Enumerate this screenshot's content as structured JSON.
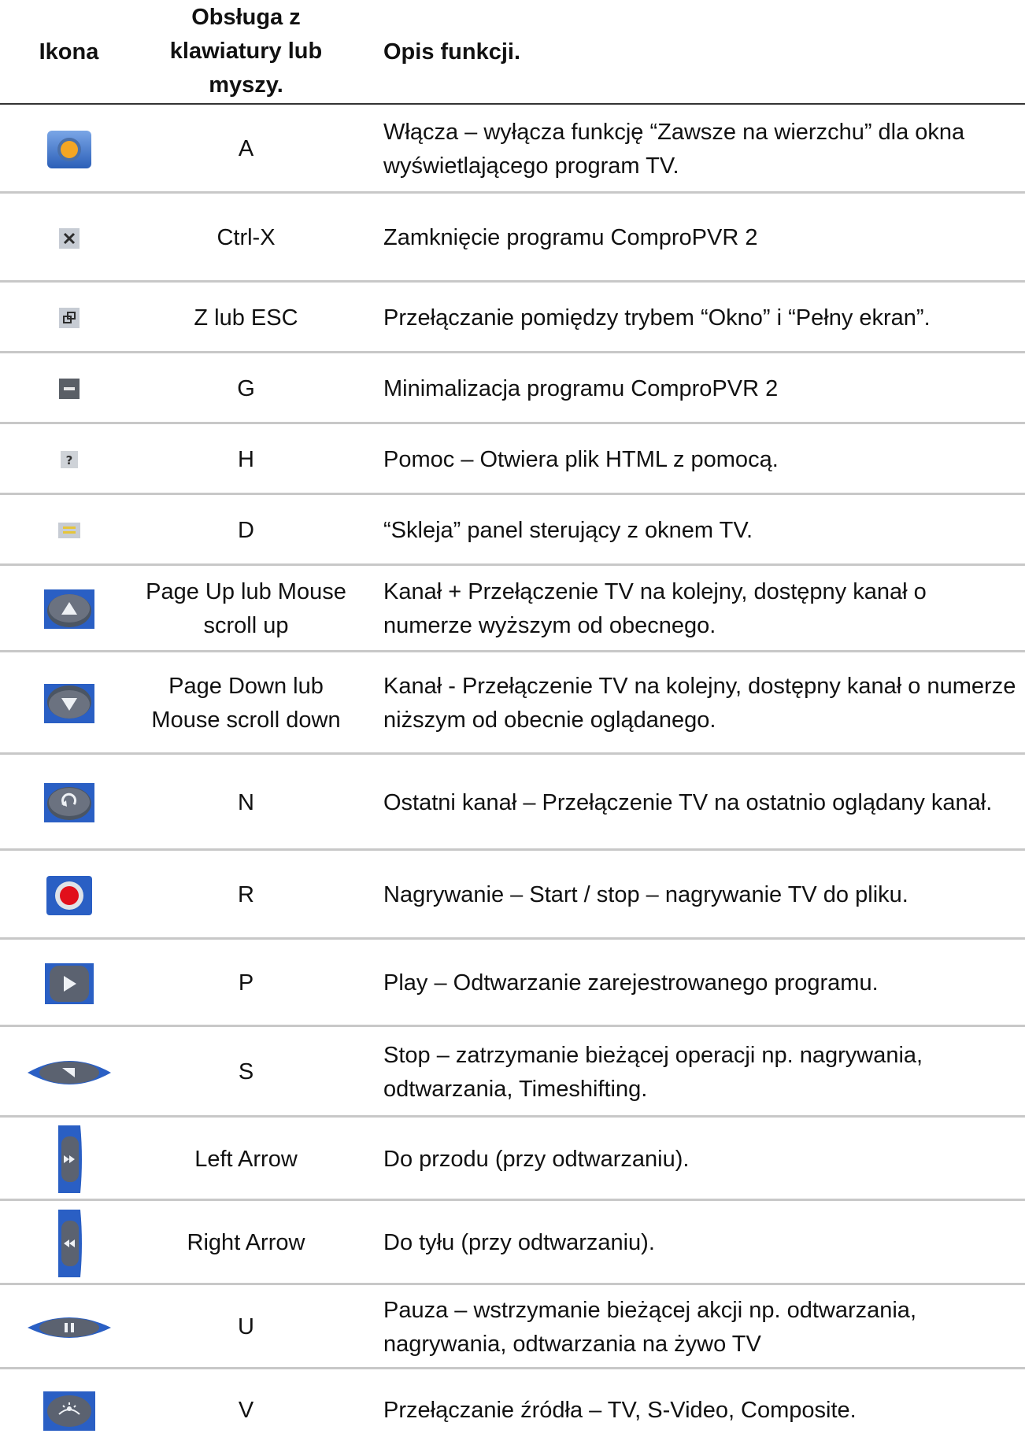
{
  "header": {
    "col_icon": "Ikona",
    "col_key": "Obsługa z klawiatury lub myszy.",
    "col_desc": "Opis funkcji."
  },
  "rows": [
    {
      "icon": "always-on-top-icon",
      "key": "A",
      "desc": "Włącza – wyłącza funkcję “Zawsze na wierzchu” dla okna wyświetlającego program TV."
    },
    {
      "icon": "close-icon",
      "key": "Ctrl-X",
      "desc": "Zamknięcie programu ComproPVR 2"
    },
    {
      "icon": "window-fullscreen-icon",
      "key": "Z lub ESC",
      "desc": "Przełączanie pomiędzy trybem “Okno” i “Pełny ekran”."
    },
    {
      "icon": "minimize-icon",
      "key": "G",
      "desc": "Minimalizacja programu ComproPVR 2"
    },
    {
      "icon": "help-icon",
      "key": "H",
      "desc": "Pomoc – Otwiera plik HTML z pomocą."
    },
    {
      "icon": "dock-panel-icon",
      "key": "D",
      "desc": "“Skleja” panel sterujący z oknem TV."
    },
    {
      "icon": "channel-up-icon",
      "key": "Page Up lub Mouse scroll up",
      "desc": "Kanał + Przełączenie TV na kolejny, dostępny kanał o numerze wyższym od obecnego."
    },
    {
      "icon": "channel-down-icon",
      "key": "Page Down lub Mouse scroll down",
      "desc": "Kanał - Przełączenie TV na kolejny, dostępny kanał o numerze niższym od obecnie oglądanego."
    },
    {
      "icon": "last-channel-icon",
      "key": "N",
      "desc": "Ostatni kanał – Przełączenie TV na ostatnio oglądany kanał."
    },
    {
      "icon": "record-icon",
      "key": "R",
      "desc": "Nagrywanie – Start / stop – nagrywanie TV do pliku."
    },
    {
      "icon": "play-icon",
      "key": "P",
      "desc": "Play – Odtwarzanie zarejestrowanego programu."
    },
    {
      "icon": "stop-icon",
      "key": "S",
      "desc": "Stop – zatrzymanie bieżącej operacji np. nagrywania, odtwarzania, Timeshifting."
    },
    {
      "icon": "fast-forward-icon",
      "key": "Left Arrow",
      "desc": "Do przodu (przy odtwarzaniu)."
    },
    {
      "icon": "rewind-icon",
      "key": "Right Arrow",
      "desc": "Do tyłu (przy odtwarzaniu)."
    },
    {
      "icon": "pause-icon",
      "key": "U",
      "desc": "Pauza – wstrzymanie bieżącej akcji np. odtwarzania, nagrywania, odtwarzania na żywo TV"
    },
    {
      "icon": "source-switch-icon",
      "key": "V",
      "desc": "Przełączanie źródła – TV, S-Video, Composite."
    }
  ]
}
